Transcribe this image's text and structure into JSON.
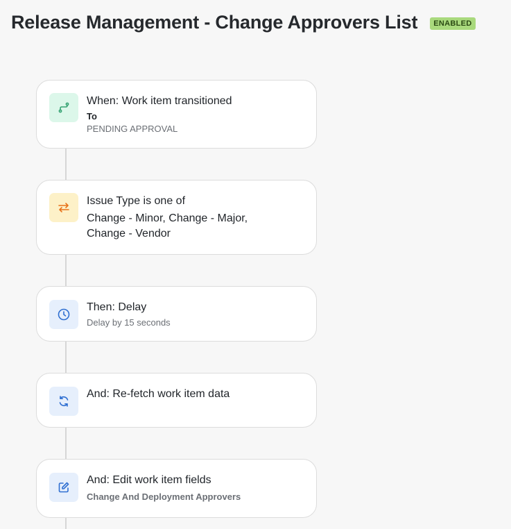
{
  "header": {
    "title": "Release Management - Change Approvers List",
    "status_badge": "ENABLED"
  },
  "rule": {
    "trigger": {
      "title": "When: Work item transitioned",
      "label": "To",
      "value": "PENDING APPROVAL",
      "icon": "branch-transition-icon"
    },
    "condition": {
      "title": "Issue Type is one of",
      "value": "Change - Minor, Change - Major, Change - Vendor",
      "icon": "swap-arrows-icon"
    },
    "delay": {
      "title": "Then: Delay",
      "detail": "Delay by 15 seconds",
      "icon": "clock-icon"
    },
    "refetch": {
      "title": "And: Re-fetch work item data",
      "icon": "refresh-icon"
    },
    "edit": {
      "title": "And: Edit work item fields",
      "detail": "Change And Deployment Approvers",
      "icon": "edit-icon"
    }
  },
  "colors": {
    "badge_bg": "#a9d97d",
    "trigger_icon": "#36a373",
    "condition_icon": "#e8731a",
    "action_icon": "#2f6fd1"
  }
}
